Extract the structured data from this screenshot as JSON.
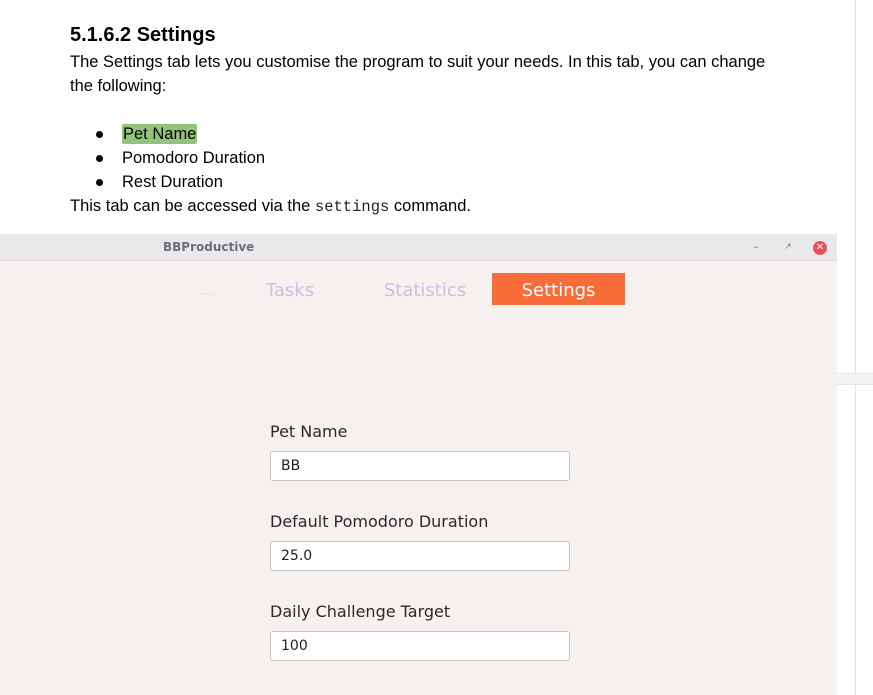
{
  "doc": {
    "heading": "5.1.6.2 Settings",
    "intro": "The Settings tab lets you customise the program to suit your needs. In this tab, you can change the following:",
    "bullets": [
      "Pet Name",
      "Pomodoro Duration",
      "Rest Duration"
    ],
    "access_prefix": "This tab can be accessed via the",
    "access_command": "settings",
    "access_suffix": "command."
  },
  "colors": {
    "highlight": "#93c47d",
    "active_tab": "#f86c3a",
    "inactive_tab_text": "#cbbfe6",
    "app_background": "#f6f0ee",
    "close_button": "#e8515a"
  },
  "app": {
    "window_title": "BBProductive",
    "window_controls": {
      "minimize": "–",
      "maximize": "↗",
      "close": "✕",
      "minimize_icon": "minimize-icon",
      "maximize_icon": "maximize-icon",
      "close_icon": "close-icon"
    },
    "tabs": [
      {
        "label": "...",
        "active": false
      },
      {
        "label": "Tasks",
        "active": false
      },
      {
        "label": "Statistics",
        "active": false
      },
      {
        "label": "Settings",
        "active": true
      }
    ],
    "fields": [
      {
        "label": "Pet Name",
        "value": "BB"
      },
      {
        "label": "Default Pomodoro Duration",
        "value": "25.0"
      },
      {
        "label": "Daily Challenge Target",
        "value": "100"
      }
    ]
  }
}
